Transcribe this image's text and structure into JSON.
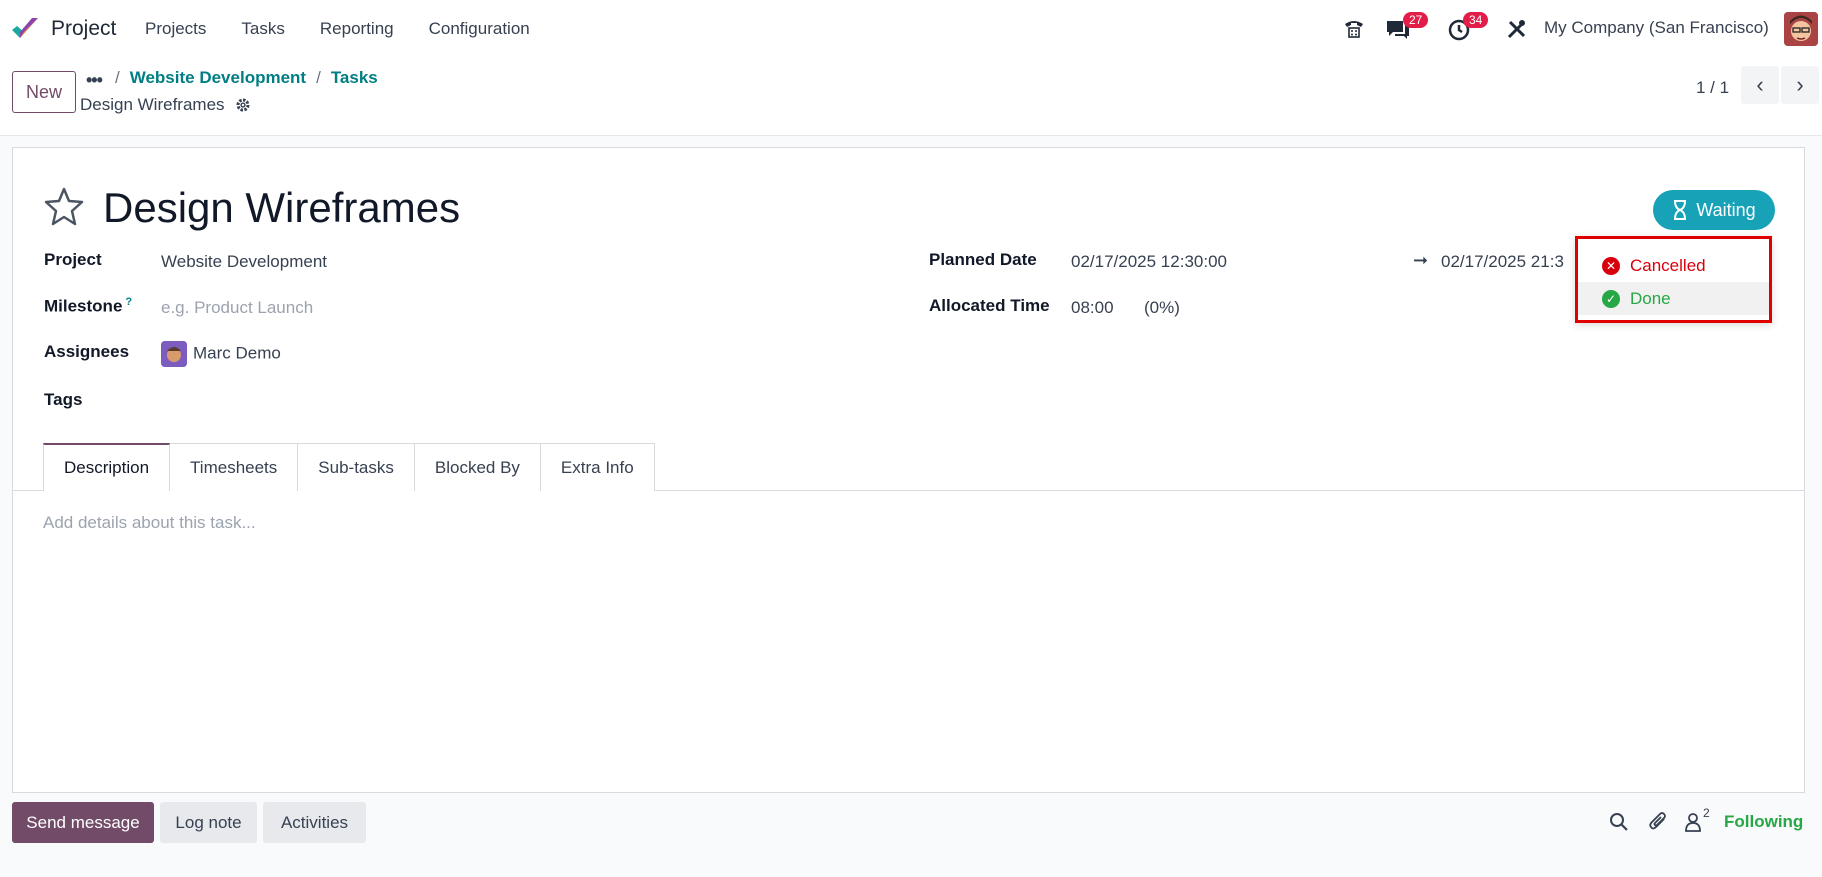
{
  "nav": {
    "app_name": "Project",
    "menu": [
      "Projects",
      "Tasks",
      "Reporting",
      "Configuration"
    ],
    "messages_count": "27",
    "activities_count": "34",
    "company": "My Company (San Francisco)"
  },
  "control": {
    "new_label": "New",
    "breadcrumb_more": "•••",
    "breadcrumbs": [
      "Website Development",
      "Tasks"
    ],
    "record_name": "Design Wireframes",
    "pager": "1 / 1"
  },
  "task": {
    "title": "Design Wireframes",
    "state_label": "Waiting",
    "fields": {
      "project_label": "Project",
      "project_value": "Website Development",
      "milestone_label": "Milestone",
      "milestone_help": "?",
      "milestone_placeholder": "e.g. Product Launch",
      "assignees_label": "Assignees",
      "assignee_name": "Marc Demo",
      "tags_label": "Tags",
      "planned_date_label": "Planned Date",
      "planned_start": "02/17/2025 12:30:00",
      "planned_end": "02/17/2025 21:3",
      "allocated_label": "Allocated Time",
      "allocated_value": "08:00",
      "allocated_pct": "(0%)"
    },
    "tabs": [
      "Description",
      "Timesheets",
      "Sub-tasks",
      "Blocked By",
      "Extra Info"
    ],
    "description_placeholder": "Add details about this task..."
  },
  "state_dropdown": {
    "items": [
      "Cancelled",
      "Done"
    ]
  },
  "chatter": {
    "send_message": "Send message",
    "log_note": "Log note",
    "activities": "Activities",
    "followers_count": "2",
    "following": "Following"
  },
  "colors": {
    "brand": "#714b67",
    "link": "#017e84",
    "waiting": "#17a2b8",
    "cancelled": "#d9000d",
    "done": "#28a745",
    "badge": "#e11d48"
  }
}
